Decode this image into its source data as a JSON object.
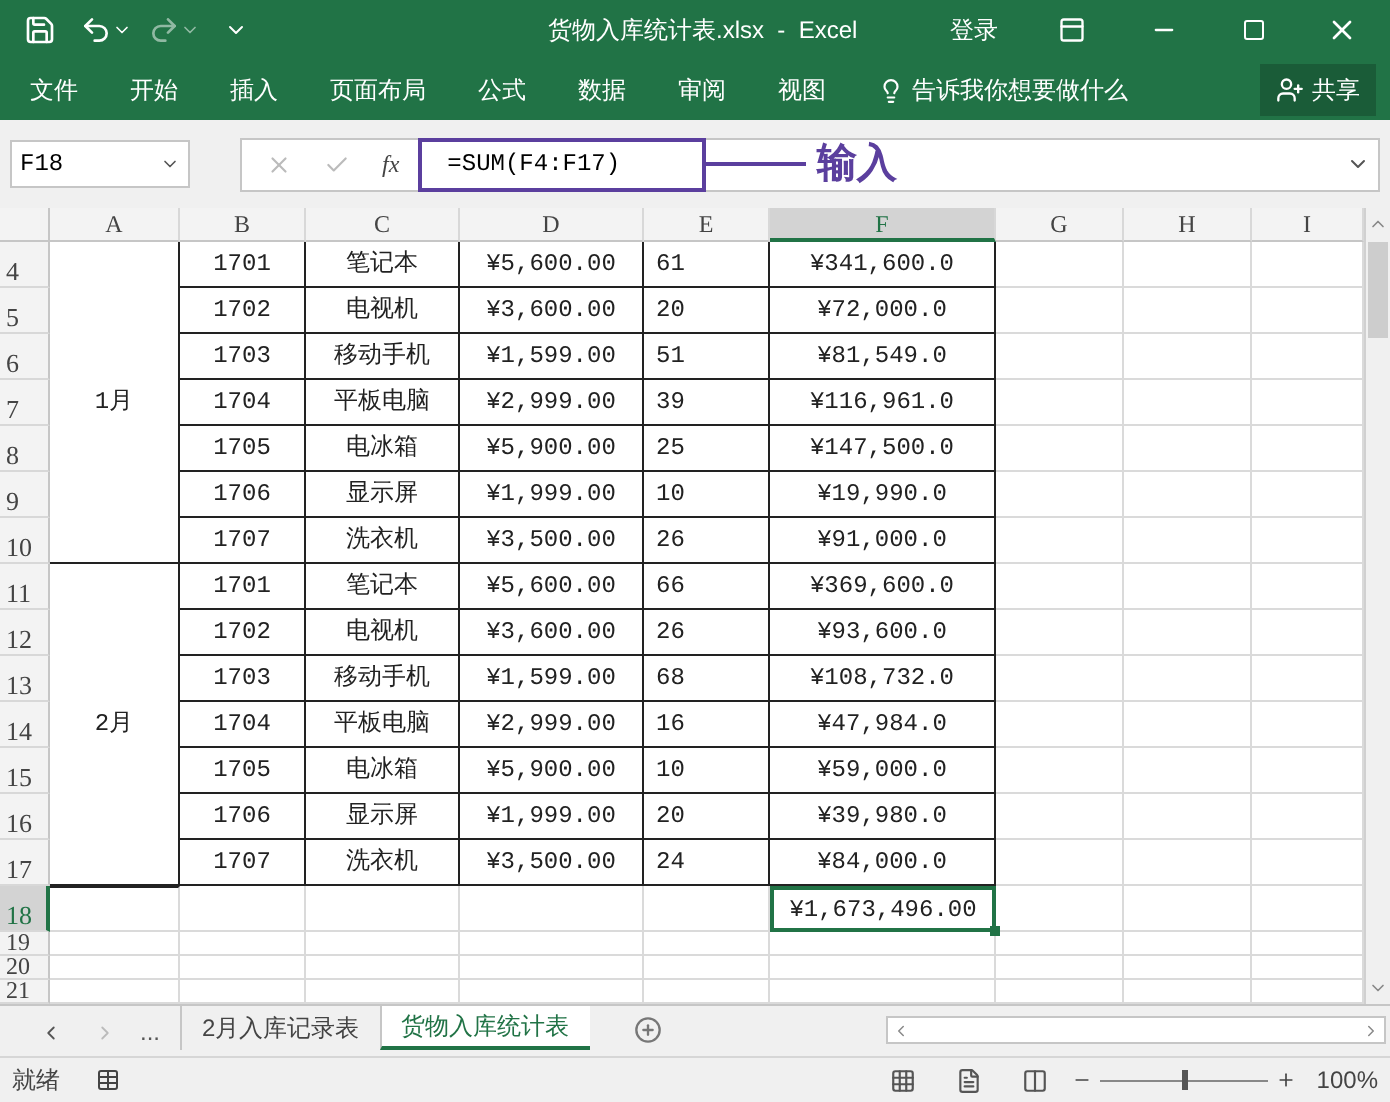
{
  "window": {
    "title": "货物入库统计表.xlsx  -  Excel",
    "sign_in": "登录"
  },
  "ribbon_tabs": [
    "文件",
    "开始",
    "插入",
    "页面布局",
    "公式",
    "数据",
    "审阅",
    "视图"
  ],
  "tell_me": "告诉我你想要做什么",
  "share": "共享",
  "formula_bar": {
    "name_box": "F18",
    "function_label": "fx",
    "formula": "=SUM(F4:F17)"
  },
  "annotation": "输入",
  "columns": [
    {
      "label": "A",
      "selected": false
    },
    {
      "label": "B",
      "selected": false
    },
    {
      "label": "C",
      "selected": false
    },
    {
      "label": "D",
      "selected": false
    },
    {
      "label": "E",
      "selected": false
    },
    {
      "label": "F",
      "selected": true
    },
    {
      "label": "G",
      "selected": false
    },
    {
      "label": "H",
      "selected": false
    },
    {
      "label": "I",
      "selected": false
    }
  ],
  "groups": [
    {
      "month": "1月",
      "rows": [
        {
          "number": "4",
          "selected": false,
          "cells": [
            "1701",
            "笔记本",
            "¥5,600.00",
            "61",
            "¥341,600.0"
          ]
        },
        {
          "number": "5",
          "selected": false,
          "cells": [
            "1702",
            "电视机",
            "¥3,600.00",
            "20",
            "¥72,000.0"
          ]
        },
        {
          "number": "6",
          "selected": false,
          "cells": [
            "1703",
            "移动手机",
            "¥1,599.00",
            "51",
            "¥81,549.0"
          ]
        },
        {
          "number": "7",
          "selected": false,
          "cells": [
            "1704",
            "平板电脑",
            "¥2,999.00",
            "39",
            "¥116,961.0"
          ]
        },
        {
          "number": "8",
          "selected": false,
          "cells": [
            "1705",
            "电冰箱",
            "¥5,900.00",
            "25",
            "¥147,500.0"
          ]
        },
        {
          "number": "9",
          "selected": false,
          "cells": [
            "1706",
            "显示屏",
            "¥1,999.00",
            "10",
            "¥19,990.0"
          ]
        },
        {
          "number": "10",
          "selected": false,
          "cells": [
            "1707",
            "洗衣机",
            "¥3,500.00",
            "26",
            "¥91,000.0"
          ]
        }
      ]
    },
    {
      "month": "2月",
      "rows": [
        {
          "number": "11",
          "selected": false,
          "cells": [
            "1701",
            "笔记本",
            "¥5,600.00",
            "66",
            "¥369,600.0"
          ]
        },
        {
          "number": "12",
          "selected": false,
          "cells": [
            "1702",
            "电视机",
            "¥3,600.00",
            "26",
            "¥93,600.0"
          ]
        },
        {
          "number": "13",
          "selected": false,
          "cells": [
            "1703",
            "移动手机",
            "¥1,599.00",
            "68",
            "¥108,732.0"
          ]
        },
        {
          "number": "14",
          "selected": false,
          "cells": [
            "1704",
            "平板电脑",
            "¥2,999.00",
            "16",
            "¥47,984.0"
          ]
        },
        {
          "number": "15",
          "selected": false,
          "cells": [
            "1705",
            "电冰箱",
            "¥5,900.00",
            "10",
            "¥59,000.0"
          ]
        },
        {
          "number": "16",
          "selected": false,
          "cells": [
            "1706",
            "显示屏",
            "¥1,999.00",
            "20",
            "¥39,980.0"
          ]
        },
        {
          "number": "17",
          "selected": false,
          "cells": [
            "1707",
            "洗衣机",
            "¥3,500.00",
            "24",
            "¥84,000.0"
          ]
        }
      ]
    }
  ],
  "total_row": {
    "number": "18",
    "selected": true,
    "amount": "¥1,673,496.00"
  },
  "empty_rows": [
    {
      "number": "19"
    },
    {
      "number": "20"
    },
    {
      "number": "21"
    }
  ],
  "sheet_tabs": [
    {
      "label": "2月入库记录表",
      "selected": false
    },
    {
      "label": "货物入库统计表",
      "selected": true
    }
  ],
  "more_sheets": "...",
  "status": {
    "ready": "就绪",
    "zoom": "100%",
    "zoom_slider": {
      "level": 0.5
    }
  }
}
